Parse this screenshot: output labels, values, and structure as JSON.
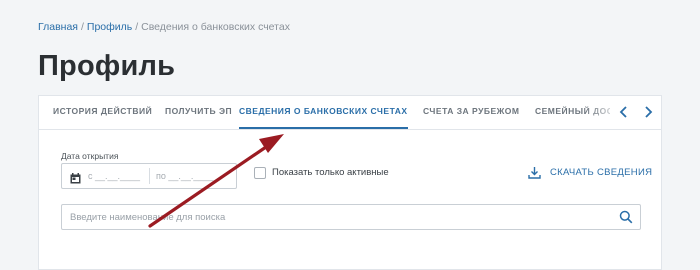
{
  "breadcrumb": {
    "home": "Главная",
    "profile": "Профиль",
    "current": "Сведения о банковских счетах",
    "separator": "/"
  },
  "page": {
    "title": "Профиль"
  },
  "tabs": [
    {
      "label": "ИСТОРИЯ ДЕЙСТВИЙ",
      "active": false
    },
    {
      "label": "ПОЛУЧИТЬ ЭП",
      "active": false
    },
    {
      "label": "СВЕДЕНИЯ О БАНКОВСКИХ СЧЕТАХ",
      "active": true
    },
    {
      "label": "СЧЕТА ЗА РУБЕЖОМ",
      "active": false
    },
    {
      "label": "СЕМЕЙНЫЙ ДОСТ",
      "active": false
    }
  ],
  "filters": {
    "date_label": "Дата открытия",
    "date_from": "с __.__.____",
    "date_to": "по __.__.____",
    "active_only_label": "Показать только активные",
    "active_only_checked": false,
    "download_label": "СКАЧАТЬ СВЕДЕНИЯ"
  },
  "search": {
    "placeholder": "Введите наименование для поиска",
    "value": ""
  },
  "colors": {
    "accent": "#2a6ea8",
    "annotation_arrow": "#9b1b22"
  },
  "icons": {
    "calendar": "calendar-icon",
    "download": "download-icon",
    "search": "search-icon",
    "prev": "chevron-left-icon",
    "next": "chevron-right-icon"
  }
}
